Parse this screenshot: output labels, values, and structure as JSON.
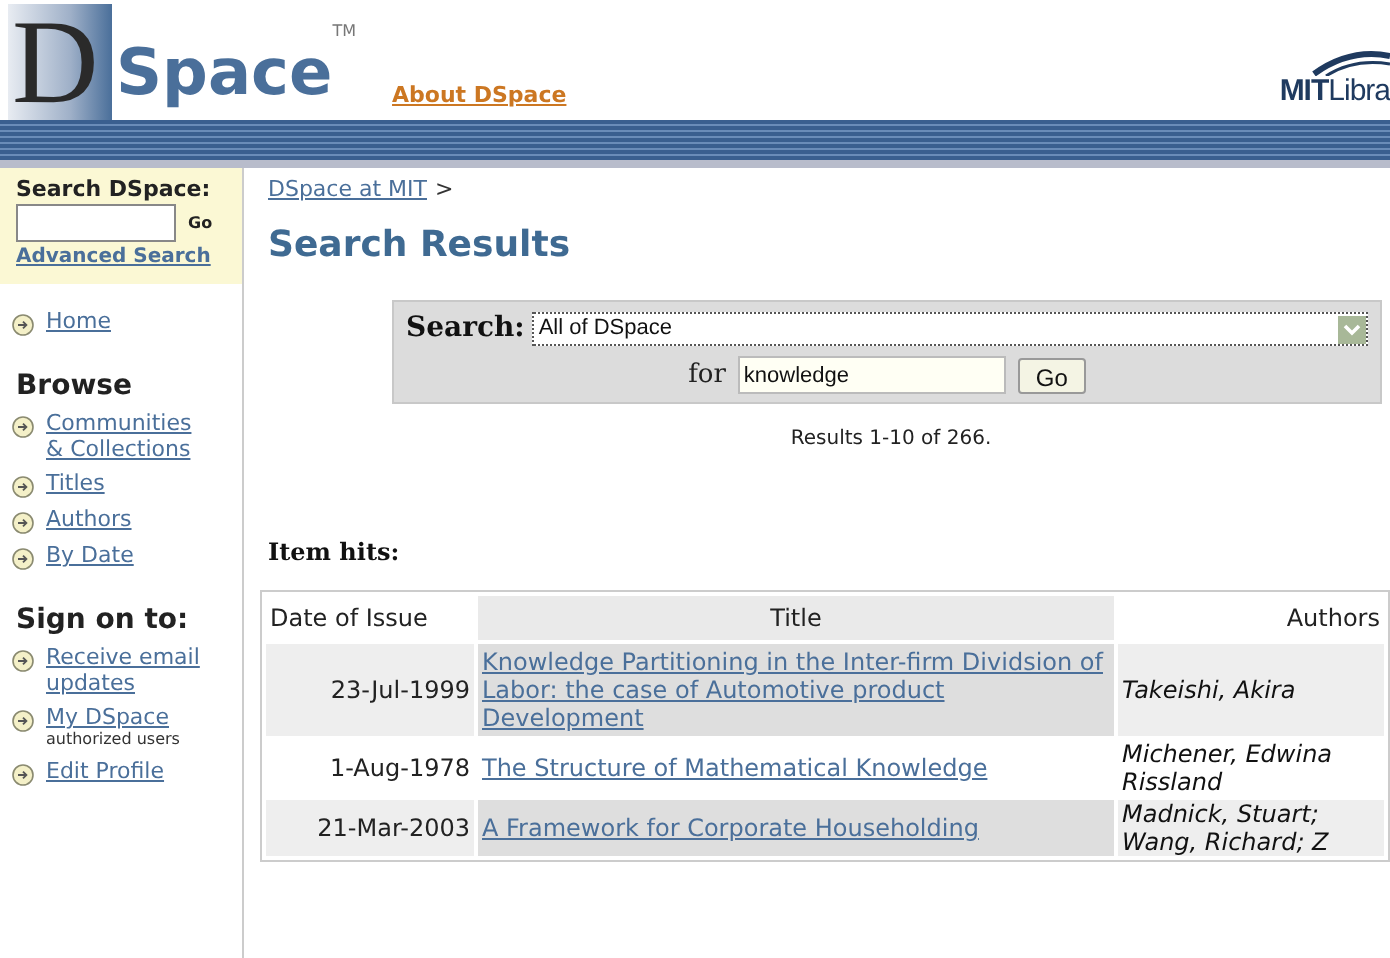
{
  "header": {
    "logo_letter": "D",
    "logo_word": "Space",
    "trademark": "TM",
    "about_link": "About DSpace",
    "partner_logo": {
      "bold": "MIT",
      "rest": "Libra"
    }
  },
  "sidebar": {
    "search": {
      "title": "Search DSpace:",
      "go": "Go",
      "advanced": "Advanced Search"
    },
    "home": "Home",
    "sections": [
      {
        "title": "Browse",
        "items": [
          {
            "label": "Communities & Collections"
          },
          {
            "label": "Titles"
          },
          {
            "label": "Authors"
          },
          {
            "label": "By Date"
          }
        ]
      },
      {
        "title": "Sign on to:",
        "items": [
          {
            "label": "Receive email updates"
          },
          {
            "label": "My DSpace",
            "note": "authorized users"
          },
          {
            "label": "Edit Profile"
          }
        ]
      }
    ]
  },
  "breadcrumb": {
    "link": "DSpace at MIT",
    "separator": ">"
  },
  "heading": "Search Results",
  "search_form": {
    "label": "Search:",
    "scope": "All of DSpace",
    "for_label": "for",
    "query": "knowledge",
    "go": "Go"
  },
  "results_count": "Results 1-10 of 266.",
  "item_hits_label": "Item hits:",
  "table": {
    "columns": [
      "Date of Issue",
      "Title",
      "Authors"
    ],
    "rows": [
      {
        "date": "23-Jul-1999",
        "title": "Knowledge Partitioning in the Inter-firm Dividsion of Labor: the case of Automotive product Development",
        "authors": [
          "Takeishi, Akira"
        ]
      },
      {
        "date": "1-Aug-1978",
        "title": "The Structure of Mathematical Knowledge",
        "authors": [
          "Michener, Edwina",
          "Rissland"
        ]
      },
      {
        "date": "21-Mar-2003",
        "title": "A Framework for Corporate Householding",
        "authors": [
          "Madnick, Stuart;",
          "Wang, Richard; Z"
        ]
      }
    ]
  }
}
